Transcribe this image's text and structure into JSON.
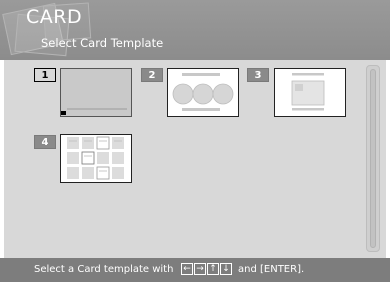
{
  "header": {
    "title": "CARD",
    "subtitle": "Select Card Template"
  },
  "templates": [
    {
      "number": "1",
      "selected": true
    },
    {
      "number": "2",
      "selected": false
    },
    {
      "number": "3",
      "selected": false
    },
    {
      "number": "4",
      "selected": false
    }
  ],
  "footer": {
    "prefix": "Select a Card template with",
    "suffix": "and [ENTER].",
    "keys": [
      "left-arrow-icon",
      "right-arrow-icon",
      "up-arrow-icon",
      "down-arrow-icon"
    ]
  },
  "colors": {
    "header_bg": "#8c8c8c",
    "panel_bg": "#d8d8d8",
    "footer_bg": "#7d7d7d",
    "number_badge_bg": "#8a8a8a"
  }
}
